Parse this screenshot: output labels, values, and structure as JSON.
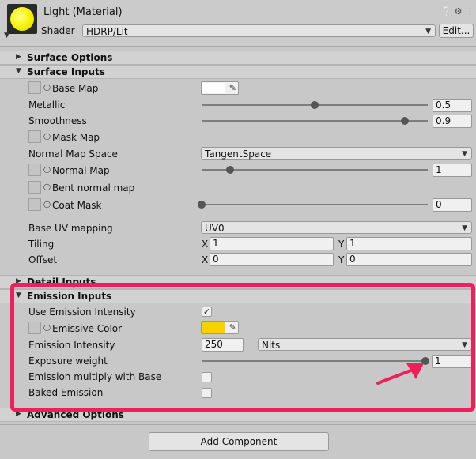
{
  "header": {
    "title": "Light (Material)",
    "shader_label": "Shader",
    "shader_value": "HDRP/Lit",
    "edit_button": "Edit..."
  },
  "sections": {
    "surface_options": "Surface Options",
    "surface_inputs": "Surface Inputs",
    "detail_inputs": "Detail Inputs",
    "emission_inputs": "Emission Inputs",
    "advanced_options": "Advanced Options"
  },
  "surface_inputs": {
    "base_map": "Base Map",
    "metallic": {
      "label": "Metallic",
      "value": "0.5",
      "fraction": 0.5
    },
    "smoothness": {
      "label": "Smoothness",
      "value": "0.9",
      "fraction": 0.9
    },
    "mask_map": "Mask Map",
    "normal_map_space": {
      "label": "Normal Map Space",
      "value": "TangentSpace"
    },
    "normal_map": {
      "label": "Normal Map",
      "value": "1",
      "fraction": 0.125
    },
    "bent_normal_map": "Bent normal map",
    "coat_mask": {
      "label": "Coat Mask",
      "value": "0",
      "fraction": 0.0
    },
    "base_uv_mapping": {
      "label": "Base UV mapping",
      "value": "UV0"
    },
    "tiling": {
      "label": "Tiling",
      "x_label": "X",
      "x": "1",
      "y_label": "Y",
      "y": "1"
    },
    "offset": {
      "label": "Offset",
      "x_label": "X",
      "x": "0",
      "y_label": "Y",
      "y": "0"
    }
  },
  "emission": {
    "use_intensity": {
      "label": "Use Emission Intensity",
      "checked": true
    },
    "emissive_color": {
      "label": "Emissive Color",
      "color": "#f7d200"
    },
    "intensity": {
      "label": "Emission Intensity",
      "value": "250",
      "unit": "Nits"
    },
    "exposure_weight": {
      "label": "Exposure weight",
      "value": "1",
      "fraction": 1.0
    },
    "multiply_base": {
      "label": "Emission multiply with Base",
      "checked": false
    },
    "baked": {
      "label": "Baked Emission",
      "checked": false
    }
  },
  "footer": {
    "add_component": "Add Component"
  },
  "colors": {
    "highlight": "#ee1f5c",
    "base_color": "#ffffff"
  }
}
